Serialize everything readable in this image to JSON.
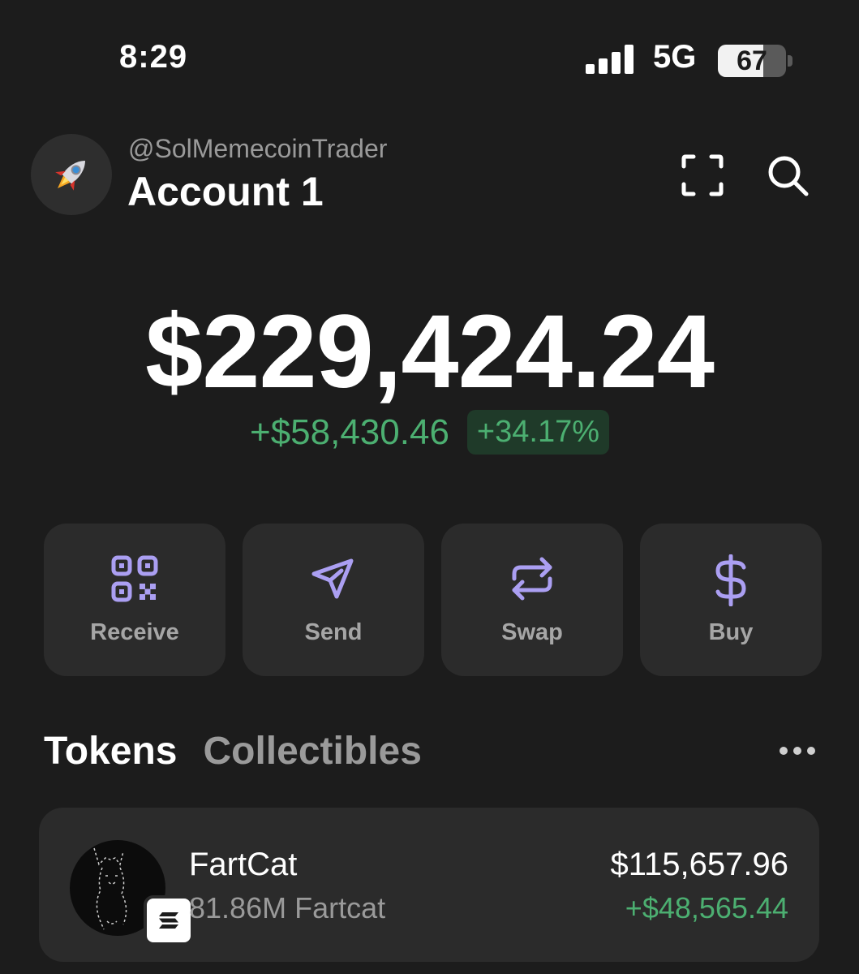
{
  "status_bar": {
    "time": "8:29",
    "network": "5G",
    "battery_percent": "67",
    "battery_level": 0.67
  },
  "header": {
    "handle": "@SolMemecoinTrader",
    "account_name": "Account 1",
    "avatar_icon": "rocket-icon",
    "scan_icon": "scan-icon",
    "search_icon": "search-icon"
  },
  "portfolio": {
    "balance": "$229,424.24",
    "change_abs": "+$58,430.46",
    "change_pct": "+34.17%"
  },
  "actions": [
    {
      "label": "Receive",
      "icon": "qr-code-icon"
    },
    {
      "label": "Send",
      "icon": "send-icon"
    },
    {
      "label": "Swap",
      "icon": "swap-icon"
    },
    {
      "label": "Buy",
      "icon": "dollar-icon"
    }
  ],
  "tabs": [
    {
      "label": "Tokens",
      "active": true
    },
    {
      "label": "Collectibles",
      "active": false
    }
  ],
  "tokens": [
    {
      "name": "FartCat",
      "amount": "81.86M Fartcat",
      "value": "$115,657.96",
      "change": "+$48,565.44"
    }
  ],
  "colors": {
    "background": "#1c1c1c",
    "card": "#2b2b2b",
    "accent_purple": "#ab9ff2",
    "positive_green": "#4caf71",
    "muted_text": "#9a9a9a"
  }
}
